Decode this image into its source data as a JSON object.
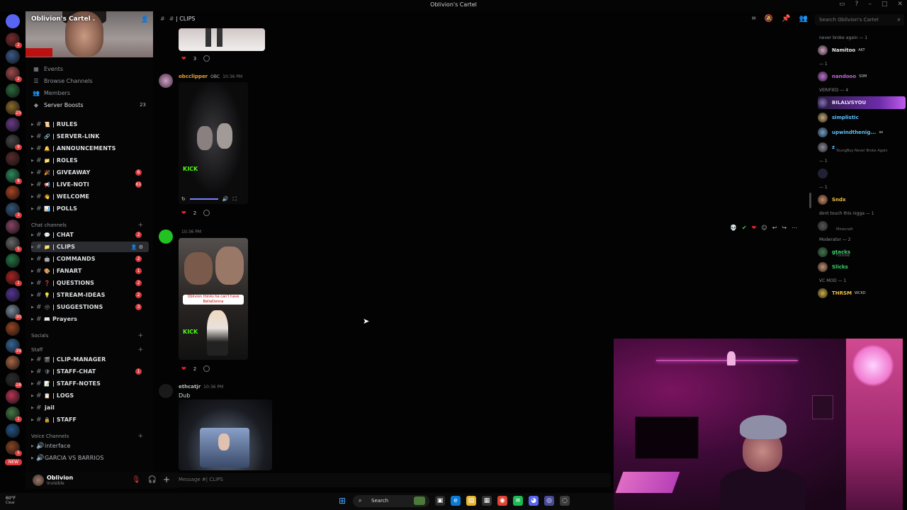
{
  "window": {
    "title": "Oblivion's Cartel"
  },
  "server": {
    "name": "Oblivion's Cartel",
    "banner_alt": "server banner"
  },
  "rail": {
    "new_label": "NEW",
    "badges": [
      "2",
      "4",
      "2",
      "3",
      "25",
      "9",
      "9",
      "2",
      "8",
      "1",
      "3",
      "4",
      "5",
      "9",
      "1",
      "17",
      "30",
      "21",
      "39",
      "41",
      "18",
      "20",
      "1",
      "75",
      "5"
    ]
  },
  "sidebar": {
    "top_items": [
      {
        "label": "Events",
        "icon": "calendar-icon"
      },
      {
        "label": "Browse Channels",
        "icon": "browse-icon"
      },
      {
        "label": "Members",
        "icon": "members-icon"
      },
      {
        "label": "Server Boosts",
        "icon": "boost-icon",
        "count": "23"
      }
    ],
    "channels_top": [
      {
        "name": "| RULES",
        "emoji": "📜",
        "badge": ""
      },
      {
        "name": "| SERVER-LINK",
        "emoji": "🔗",
        "badge": ""
      },
      {
        "name": "| ANNOUNCEMENTS",
        "emoji": "🔔",
        "badge": ""
      },
      {
        "name": "| ROLES",
        "emoji": "📁",
        "badge": ""
      },
      {
        "name": "| GIVEAWAY",
        "emoji": "🎉",
        "badge": "6"
      },
      {
        "name": "| LIVE-NOTI",
        "emoji": "📢",
        "badge": "61"
      },
      {
        "name": "| WELCOME",
        "emoji": "👋",
        "badge": ""
      },
      {
        "name": "| POLLS",
        "emoji": "📊",
        "badge": ""
      }
    ],
    "cat_chat": "Chat channels",
    "channels_chat": [
      {
        "name": "| CHAT",
        "emoji": "💬",
        "badge": "2"
      },
      {
        "name": "| CLIPS",
        "emoji": "📁",
        "badge": "",
        "active": true
      },
      {
        "name": "| COMMANDS",
        "emoji": "🤖",
        "badge": "2"
      },
      {
        "name": "| FANART",
        "emoji": "🎨",
        "badge": "1"
      },
      {
        "name": "| QUESTIONS",
        "emoji": "❓",
        "badge": "2"
      },
      {
        "name": "| STREAM-IDEAS",
        "emoji": "💡",
        "badge": "2"
      },
      {
        "name": "| SUGGESTIONS",
        "emoji": "🗳",
        "badge": "3"
      },
      {
        "name": "Prayers",
        "emoji": "📖",
        "badge": ""
      }
    ],
    "cat_socials": "Socials",
    "cat_staff": "Staff",
    "channels_staff": [
      {
        "name": "| CLIP-MANAGER",
        "emoji": "🎬",
        "badge": ""
      },
      {
        "name": "| STAFF-CHAT",
        "emoji": "🛡",
        "badge": "1"
      },
      {
        "name": "| STAFF-NOTES",
        "emoji": "📝",
        "badge": ""
      },
      {
        "name": "| LOGS",
        "emoji": "📋",
        "badge": ""
      },
      {
        "name": "jail",
        "emoji": "",
        "badge": ""
      },
      {
        "name": "| STAFF",
        "emoji": "🔒",
        "badge": ""
      }
    ],
    "cat_voice": "Voice Channels",
    "voice_channels": [
      {
        "name": "interface"
      },
      {
        "name": "GARCIA VS BARRIOS"
      }
    ]
  },
  "user": {
    "name": "Oblivion",
    "status": "Invisible"
  },
  "chat": {
    "channel": "| CLIPS",
    "composer_placeholder": "Message #| CLIPS",
    "messages": [
      {
        "author": "",
        "reaction_count": "3"
      },
      {
        "author": "obcclipper",
        "tag": "OBC",
        "time": "10:36 PM",
        "author_color": "#e8a23a",
        "reaction_count": "2",
        "clip_text": "KICK"
      },
      {
        "author": "",
        "time": "10:36 PM",
        "reaction_count": "2",
        "clip_caption": "Oblivion thinks he can't have BellaDonna",
        "clip_text": "KICK"
      },
      {
        "author": "ethcatjr",
        "time": "10:36 PM",
        "author_color": "#b6b9be",
        "text": "Dub"
      }
    ]
  },
  "search": {
    "placeholder": "Search Oblivion's Cartel"
  },
  "members": {
    "groups": [
      {
        "label": "never broke again — 1",
        "members": [
          {
            "name": "Namitoo",
            "tag": "AKT",
            "color": "#e3e5e8"
          }
        ]
      },
      {
        "label": "— 1",
        "members": [
          {
            "name": "nandooo",
            "tag": "SDM",
            "color": "#c26ad8"
          }
        ]
      },
      {
        "label": "VERIFIED — 4",
        "members": [
          {
            "name": "BILALVSYOU",
            "color": "#e8d8ff",
            "highlight": true
          },
          {
            "name": "simplistic",
            "color": "#5bc0ff"
          },
          {
            "name": "upwindthenig...",
            "color": "#5bc0ff",
            "tag": "xe"
          },
          {
            "name": "z",
            "color": "#5bc0ff",
            "status": "YoungBoy Never Broke Again"
          }
        ]
      },
      {
        "label": "— 1",
        "members": [
          {
            "name": "",
            "color": "#8e9297"
          }
        ]
      },
      {
        "label": "— 1",
        "members": [
          {
            "name": "Sndx",
            "color": "#f0c040"
          }
        ]
      },
      {
        "label": "dont touch this nigga — 1",
        "members": [
          {
            "name": "",
            "color": "#8e9297",
            "status": "Minecraft"
          }
        ]
      },
      {
        "label": "Moderator — 2",
        "members": [
          {
            "name": "gtacks",
            "color": "#3bd16f",
            "status": "Fortnite"
          },
          {
            "name": "Slicks",
            "color": "#3bd16f"
          }
        ]
      },
      {
        "label": "VC MOD — 1",
        "members": [
          {
            "name": "THRSM",
            "tag": "WCKD",
            "color": "#f0c040"
          }
        ]
      }
    ]
  },
  "taskbar": {
    "temp": "60°F",
    "condition": "Clear",
    "search_label": "Search"
  },
  "colors": {
    "accent": "#5865f2",
    "danger": "#d83c3e",
    "kick_green": "#53fc18"
  }
}
